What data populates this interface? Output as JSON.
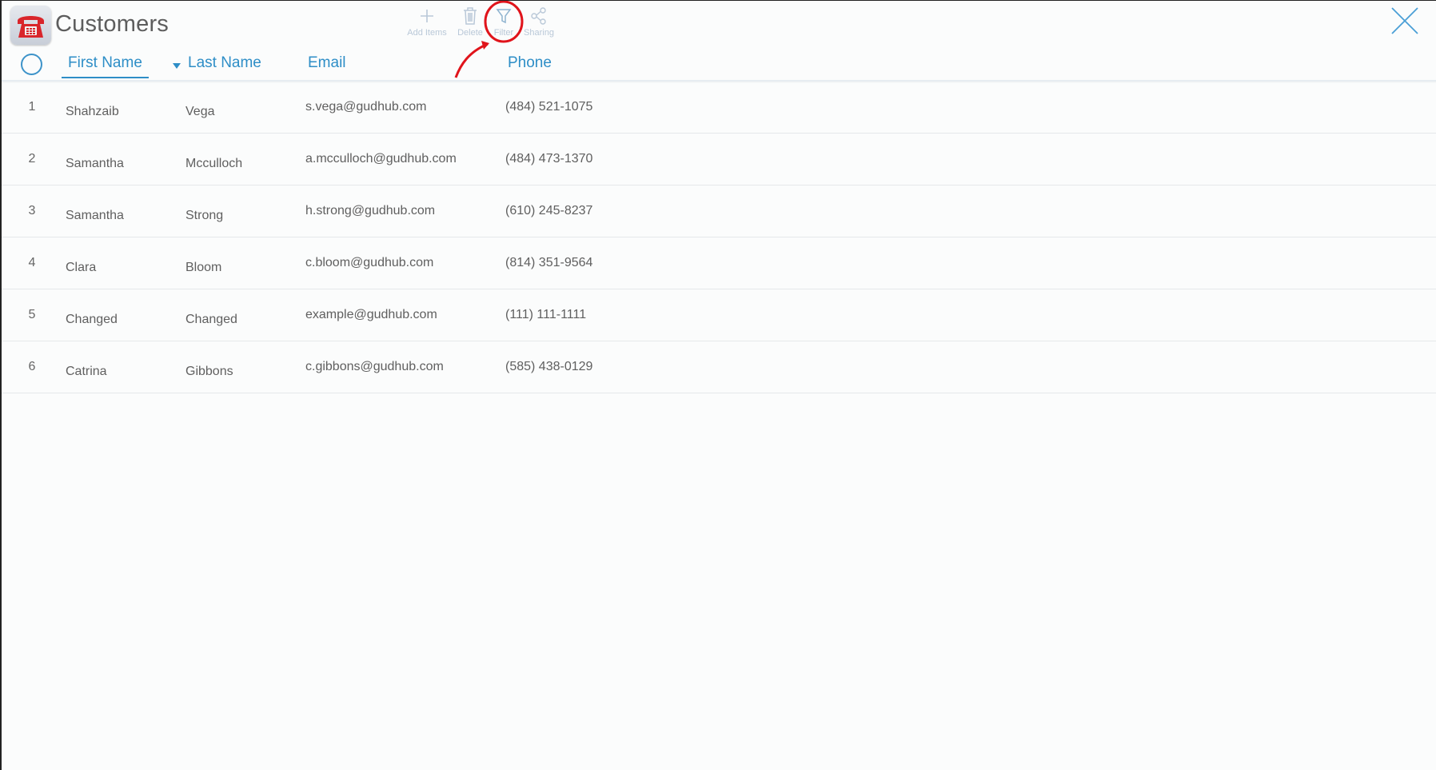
{
  "app": {
    "title": "Customers"
  },
  "toolbar": {
    "add_items_label": "Add Items",
    "delete_label": "Delete",
    "filter_label": "Filter",
    "sharing_label": "Sharing"
  },
  "table": {
    "columns": {
      "first_name": "First Name",
      "last_name": "Last Name",
      "email": "Email",
      "phone": "Phone"
    },
    "sorted_column": "First Name",
    "rows": [
      {
        "num": "1",
        "first": "Shahzaib",
        "last": "Vega",
        "email": "s.vega@gudhub.com",
        "phone": "(484) 521-1075"
      },
      {
        "num": "2",
        "first": "Samantha",
        "last": "Mcculloch",
        "email": "a.mcculloch@gudhub.com",
        "phone": "(484) 473-1370"
      },
      {
        "num": "3",
        "first": "Samantha",
        "last": "Strong",
        "email": "h.strong@gudhub.com",
        "phone": "(610) 245-8237"
      },
      {
        "num": "4",
        "first": "Clara",
        "last": "Bloom",
        "email": "c.bloom@gudhub.com",
        "phone": "(814) 351-9564"
      },
      {
        "num": "5",
        "first": "Changed",
        "last": "Changed",
        "email": "example@gudhub.com",
        "phone": "(111) 111-1111"
      },
      {
        "num": "6",
        "first": "Catrina",
        "last": "Gibbons",
        "email": "c.gibbons@gudhub.com",
        "phone": "(585) 438-0129"
      }
    ]
  },
  "colors": {
    "accent": "#2e8ec7",
    "toolbar_icon": "#b9c8d8",
    "annotation": "#e0141b",
    "app_icon_phone": "#d9262b"
  },
  "icons": {
    "app": "red-telephone-icon",
    "add": "plus-icon",
    "delete": "trash-icon",
    "filter": "funnel-icon",
    "sharing": "share-icon",
    "close": "close-icon"
  }
}
